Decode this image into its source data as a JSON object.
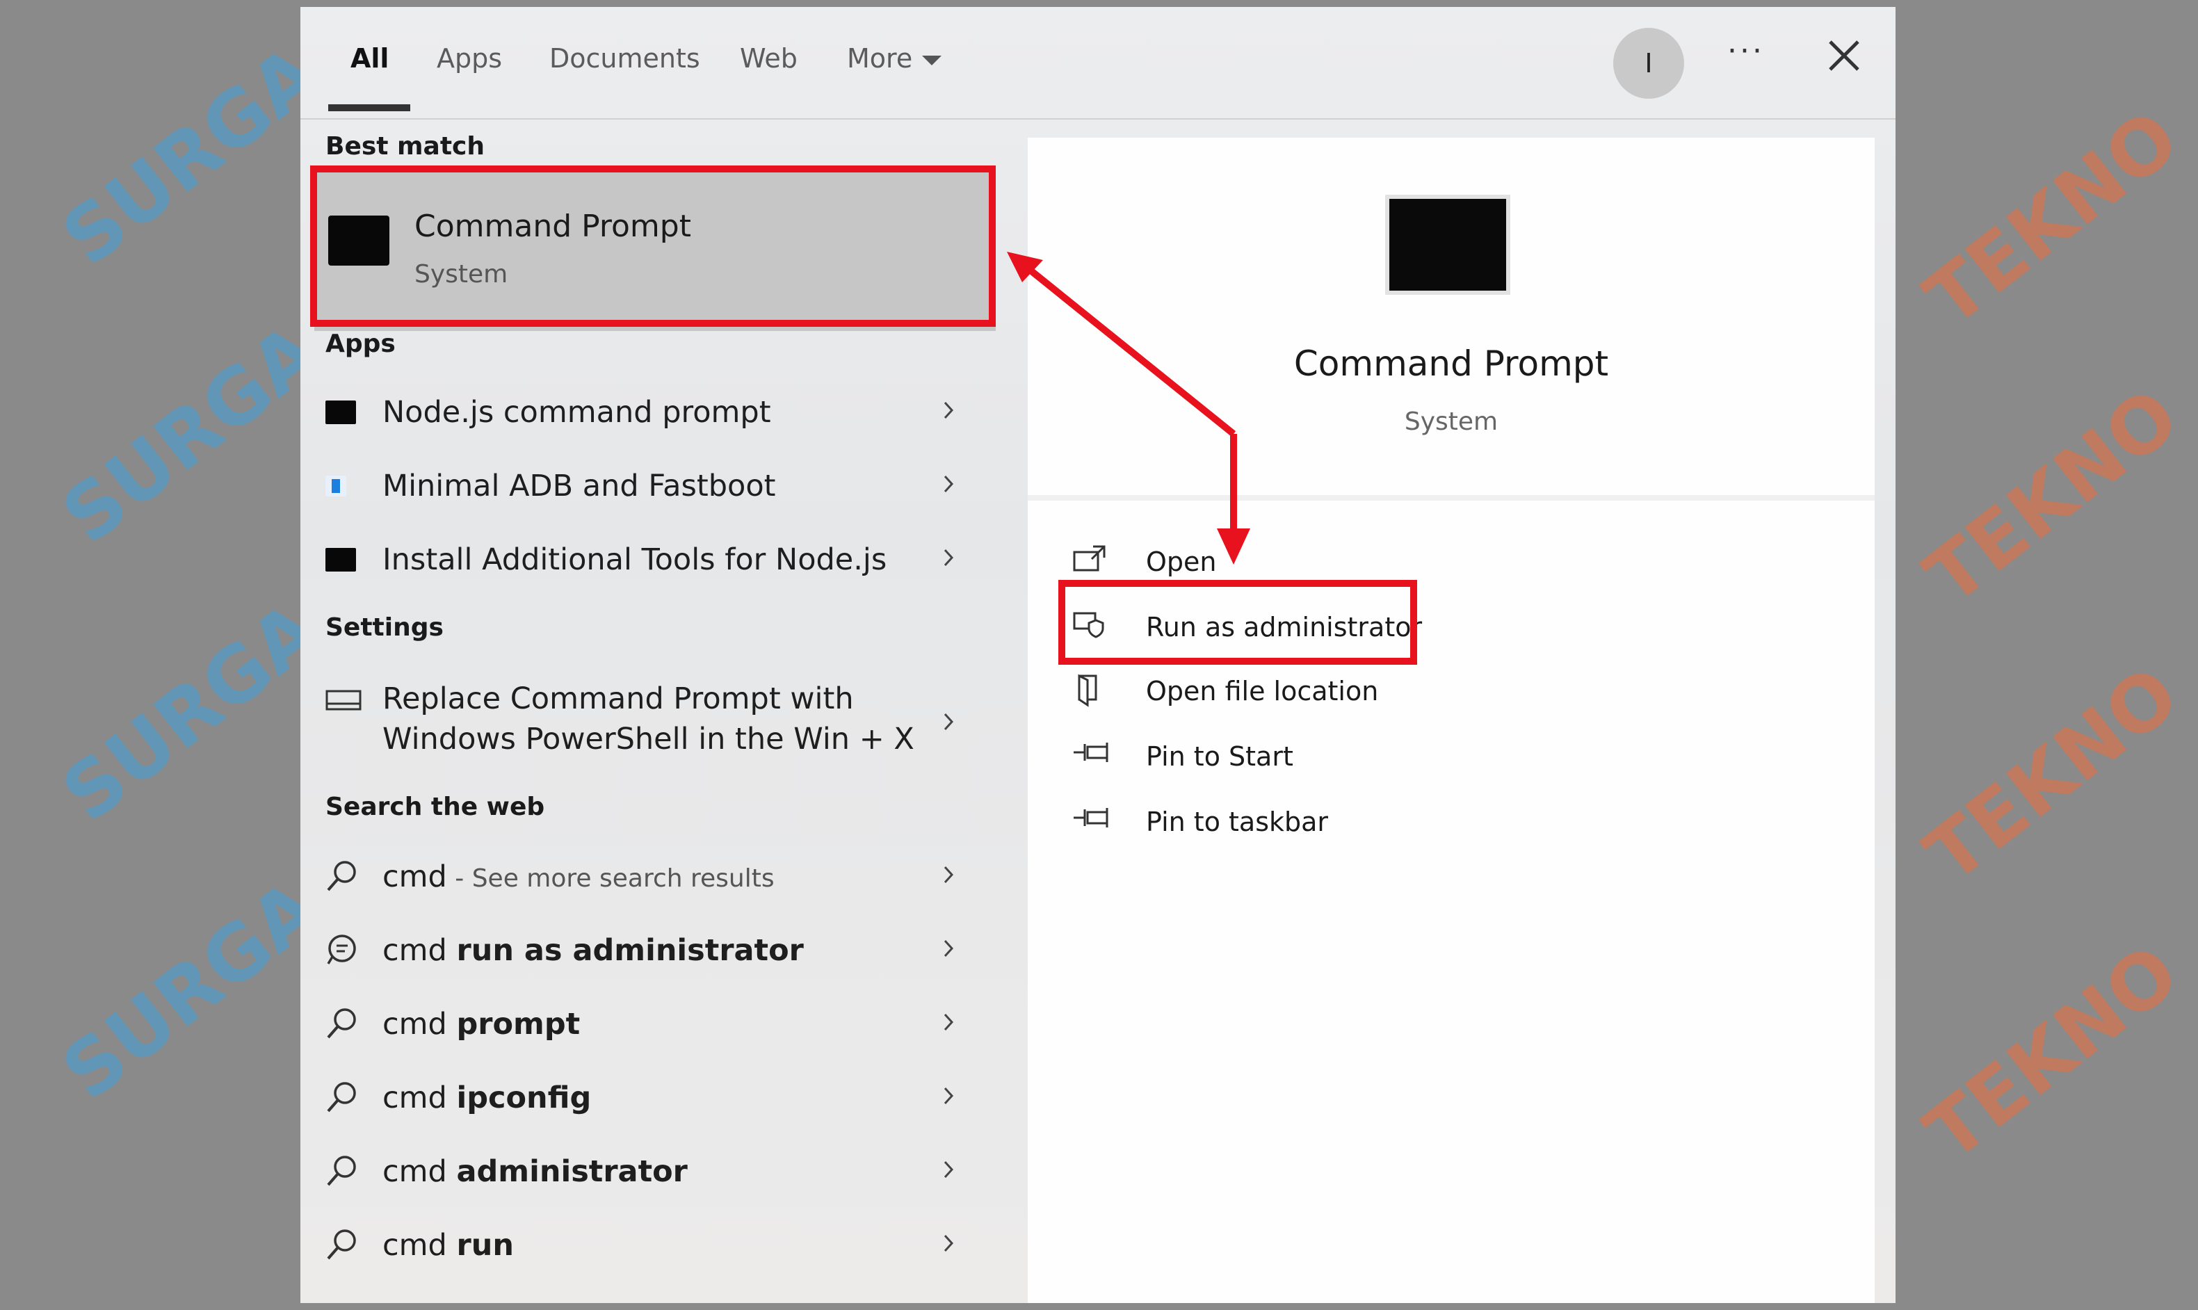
{
  "tabs": [
    "All",
    "Apps",
    "Documents",
    "Web",
    "More"
  ],
  "user_initial": "I",
  "sections": {
    "best_match": "Best match",
    "apps": "Apps",
    "settings": "Settings",
    "search_web": "Search the web"
  },
  "best_match": {
    "title": "Command Prompt",
    "subtitle": "System"
  },
  "apps": [
    {
      "label": "Node.js command prompt",
      "icon": "terminal-icon"
    },
    {
      "label": "Minimal ADB and Fastboot",
      "icon": "adb-app-icon"
    },
    {
      "label": "Install Additional Tools for Node.js",
      "icon": "terminal-icon"
    }
  ],
  "settings_items": [
    {
      "line1": "Replace Command Prompt with",
      "line2": "Windows PowerShell in the Win + X",
      "icon": "settings-window-icon"
    }
  ],
  "web": {
    "first": {
      "term": "cmd",
      "suffix": " - See more search results"
    },
    "items": [
      {
        "prefix": "cmd ",
        "bold": "run as administrator",
        "icon": "chat-search-icon"
      },
      {
        "prefix": "cmd ",
        "bold": "prompt",
        "icon": "search-icon"
      },
      {
        "prefix": "cmd ",
        "bold": "ipconfig",
        "icon": "search-icon"
      },
      {
        "prefix": "cmd ",
        "bold": "administrator",
        "icon": "search-icon"
      },
      {
        "prefix": "cmd ",
        "bold": "run",
        "icon": "search-icon"
      }
    ]
  },
  "detail": {
    "title": "Command Prompt",
    "subtitle": "System",
    "actions": [
      {
        "label": "Open",
        "icon": "open-icon"
      },
      {
        "label": "Run as administrator",
        "icon": "shield-admin-icon"
      },
      {
        "label": "Open file location",
        "icon": "file-location-icon"
      },
      {
        "label": "Pin to Start",
        "icon": "pin-icon"
      },
      {
        "label": "Pin to taskbar",
        "icon": "pin-icon"
      }
    ]
  },
  "colors": {
    "highlight": "#e8121e",
    "accent": "#0078d4"
  },
  "watermark": [
    "SURGA",
    "TEKNO"
  ]
}
